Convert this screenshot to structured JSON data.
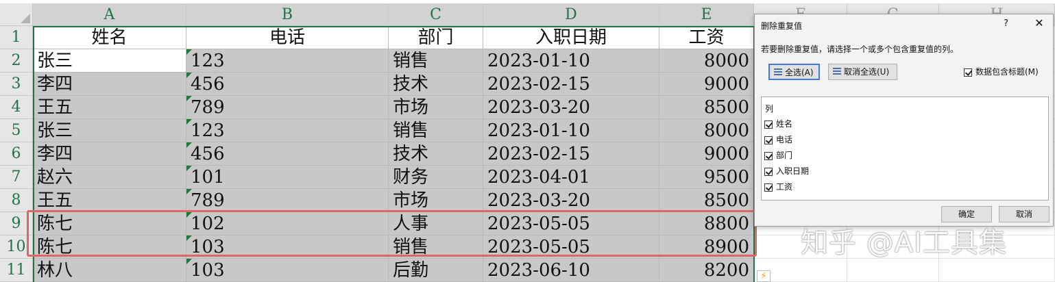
{
  "sheet": {
    "columns": [
      "A",
      "B",
      "C",
      "D",
      "E",
      "F",
      "G",
      "H"
    ],
    "rows": [
      {
        "num": "1",
        "cells": [
          "姓名",
          "电话",
          "部门",
          "入职日期",
          "工资"
        ]
      },
      {
        "num": "2",
        "cells": [
          "张三",
          "123",
          "销售",
          "2023-01-10",
          "8000"
        ]
      },
      {
        "num": "3",
        "cells": [
          "李四",
          "456",
          "技术",
          "2023-02-15",
          "9000"
        ]
      },
      {
        "num": "4",
        "cells": [
          "王五",
          "789",
          "市场",
          "2023-03-20",
          "8500"
        ]
      },
      {
        "num": "5",
        "cells": [
          "张三",
          "123",
          "销售",
          "2023-01-10",
          "8000"
        ]
      },
      {
        "num": "6",
        "cells": [
          "李四",
          "456",
          "技术",
          "2023-02-15",
          "9000"
        ]
      },
      {
        "num": "7",
        "cells": [
          "赵六",
          "101",
          "财务",
          "2023-04-01",
          "9500"
        ]
      },
      {
        "num": "8",
        "cells": [
          "王五",
          "789",
          "市场",
          "2023-03-20",
          "8500"
        ]
      },
      {
        "num": "9",
        "cells": [
          "陈七",
          "102",
          "人事",
          "2023-05-05",
          "8800"
        ]
      },
      {
        "num": "10",
        "cells": [
          "陈七",
          "103",
          "销售",
          "2023-05-05",
          "8900"
        ]
      },
      {
        "num": "11",
        "cells": [
          "林八",
          "103",
          "后勤",
          "2023-06-10",
          "8200"
        ]
      }
    ]
  },
  "dialog": {
    "title": "删除重复值",
    "help": "?",
    "close": "✕",
    "description": "若要删除重复值，请选择一个或多个包含重复值的列。",
    "select_all": "全选(A)",
    "unselect_all": "取消全选(U)",
    "has_headers": "数据包含标题(M)",
    "list_title": "列",
    "columns": [
      "姓名",
      "电话",
      "部门",
      "入职日期",
      "工资"
    ],
    "ok": "确定",
    "cancel": "取消"
  },
  "watermark": "知乎 @AI工具集",
  "quick_analysis_icon": "lightning-icon",
  "colors": {
    "accent": "#217346",
    "selection": "#c8c8c8",
    "highlight": "#e06666"
  }
}
